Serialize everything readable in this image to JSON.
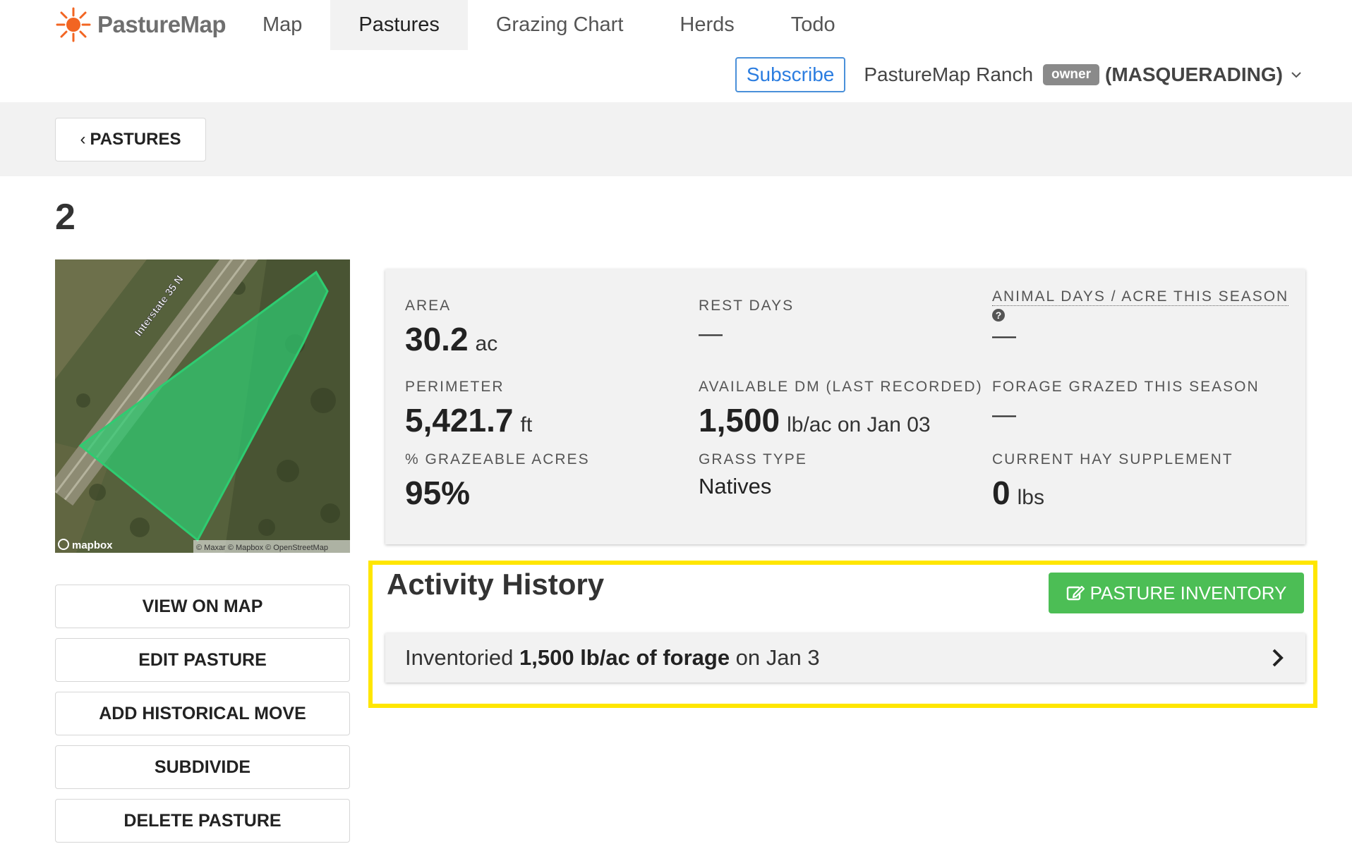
{
  "brand": {
    "name": "PastureMap",
    "accent": "#f26522"
  },
  "nav": {
    "tabs": [
      {
        "label": "Map",
        "active": false
      },
      {
        "label": "Pastures",
        "active": true
      },
      {
        "label": "Grazing Chart",
        "active": false
      },
      {
        "label": "Herds",
        "active": false
      },
      {
        "label": "Todo",
        "active": false
      }
    ]
  },
  "userbar": {
    "subscribe_label": "Subscribe",
    "ranch_name": "PastureMap Ranch",
    "role": "owner",
    "mode": "(MASQUERADING)"
  },
  "breadcrumb": {
    "back_label": "PASTURES",
    "back_icon": "chevron-left-icon"
  },
  "page": {
    "title": "2"
  },
  "map": {
    "road_label": "Interstate 35 N",
    "attribution_logo": "mapbox",
    "attribution_text": "© Maxar © Mapbox © OpenStreetMap",
    "polygon_color": "#2ecc71"
  },
  "actions": [
    {
      "label": "VIEW ON MAP"
    },
    {
      "label": "EDIT PASTURE"
    },
    {
      "label": "ADD HISTORICAL MOVE"
    },
    {
      "label": "SUBDIVIDE"
    },
    {
      "label": "DELETE PASTURE"
    }
  ],
  "stats": {
    "area": {
      "label": "AREA",
      "value": "30.2",
      "unit": "ac"
    },
    "rest_days": {
      "label": "REST DAYS",
      "value": "—"
    },
    "animal_days": {
      "label": "ANIMAL DAYS / ACRE THIS SEASON",
      "value": "—",
      "help_icon": "question-circle-icon"
    },
    "perimeter": {
      "label": "PERIMETER",
      "value": "5,421.7",
      "unit": "ft"
    },
    "available_dm": {
      "label": "AVAILABLE DM (LAST RECORDED)",
      "value": "1,500",
      "unit": "lb/ac on Jan 03"
    },
    "forage_grazed": {
      "label": "FORAGE GRAZED THIS SEASON",
      "value": "—"
    },
    "grazeable": {
      "label": "% GRAZEABLE ACRES",
      "value": "95%"
    },
    "grass_type": {
      "label": "GRASS TYPE",
      "value": "Natives"
    },
    "hay_supplement": {
      "label": "CURRENT HAY SUPPLEMENT",
      "value": "0",
      "unit": "lbs"
    }
  },
  "activity": {
    "title": "Activity History",
    "inventory_button": "PASTURE INVENTORY",
    "inventory_icon": "edit-icon",
    "highlight_color": "#ffe600",
    "items": [
      {
        "prefix": "Inventoried ",
        "bold": "1,500 lb/ac of forage",
        "suffix": " on Jan 3"
      }
    ]
  }
}
